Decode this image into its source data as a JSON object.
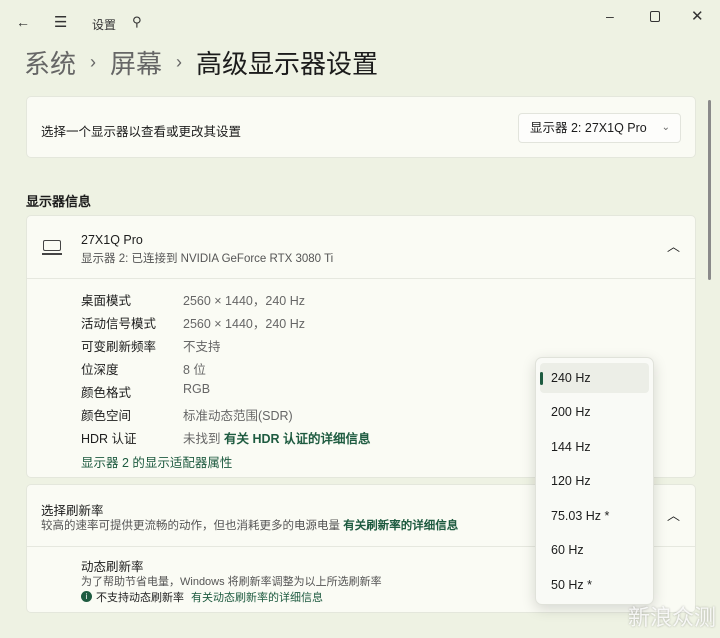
{
  "titlebar": {
    "app_title": "设置"
  },
  "breadcrumb": {
    "items": [
      "系统",
      "屏幕"
    ],
    "current": "高级显示器设置"
  },
  "select_display": {
    "label": "选择一个显示器以查看或更改其设置",
    "value": "显示器 2: 27X1Q Pro"
  },
  "display_info": {
    "section_title": "显示器信息",
    "name": "27X1Q Pro",
    "subtitle": "显示器 2: 已连接到 NVIDIA GeForce RTX 3080 Ti",
    "rows": [
      {
        "label": "桌面模式",
        "value": "2560 × 1440，240 Hz"
      },
      {
        "label": "活动信号模式",
        "value": "2560 × 1440，240 Hz"
      },
      {
        "label": "可变刷新频率",
        "value": "不支持"
      },
      {
        "label": "位深度",
        "value": "8 位"
      },
      {
        "label": "颜色格式",
        "value": "RGB"
      },
      {
        "label": "颜色空间",
        "value": "标准动态范围(SDR)"
      },
      {
        "label": "HDR 认证",
        "value": "未找到",
        "link": "有关 HDR 认证的详细信息"
      }
    ],
    "adapter_link": "显示器 2 的显示适配器属性"
  },
  "refresh": {
    "title": "选择刷新率",
    "desc": "较高的速率可提供更流畅的动作，但也消耗更多的电源电量",
    "link": "有关刷新率的详细信息",
    "dynamic_title": "动态刷新率",
    "dynamic_desc": "为了帮助节省电量，Windows 将刷新率调整为以上所选刷新率",
    "dynamic_status": "不支持动态刷新率",
    "dynamic_link": "有关动态刷新率的详细信息"
  },
  "dropdown": {
    "options": [
      "240 Hz",
      "200 Hz",
      "144 Hz",
      "120 Hz",
      "75.03 Hz *",
      "60 Hz",
      "50 Hz *"
    ],
    "selected": "240 Hz"
  },
  "watermark": "新浪众测",
  "colors": {
    "accent": "#1e5b40"
  }
}
